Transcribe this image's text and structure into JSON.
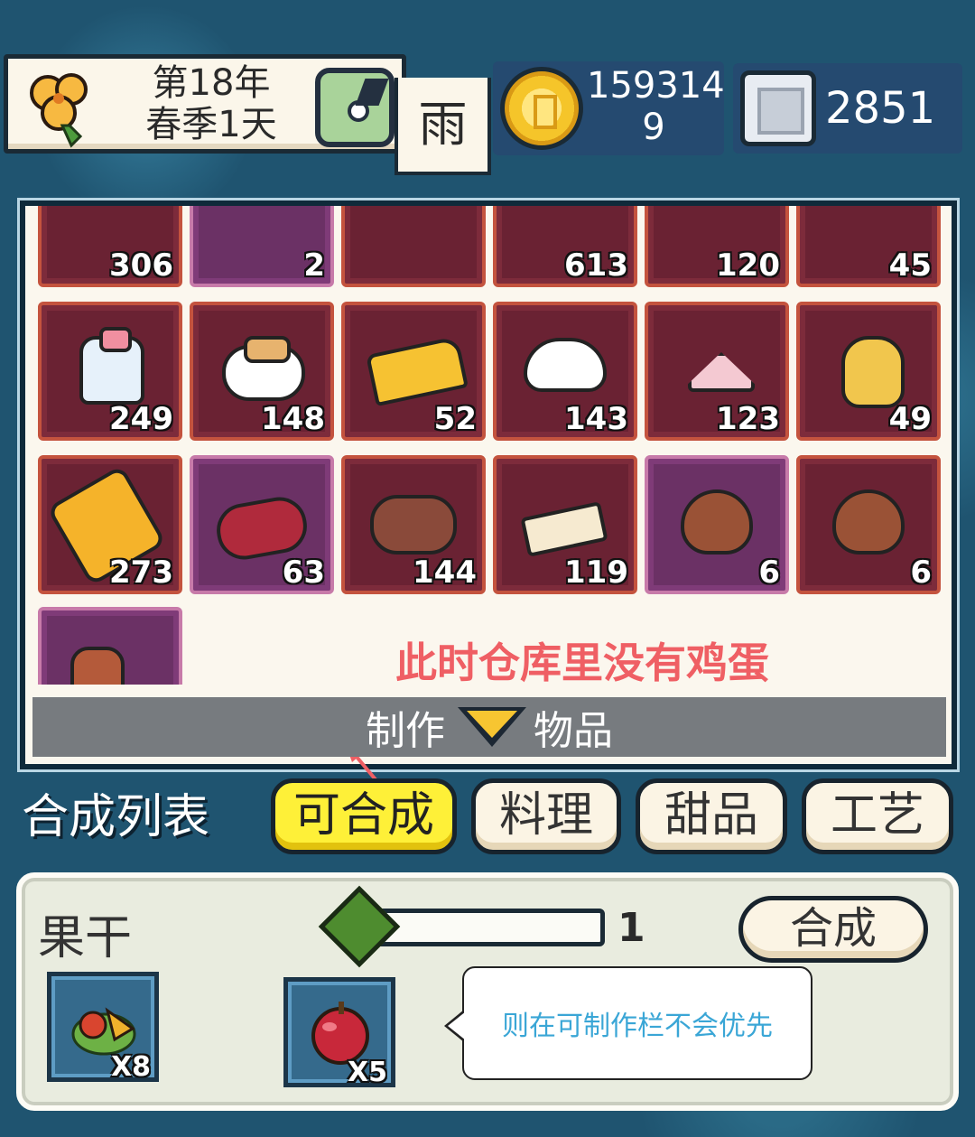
{
  "hud": {
    "date_line1": "第18年",
    "date_line2": "春季1天",
    "weather": "雨",
    "coins_line1": "159314",
    "coins_line2": "9",
    "gems": "2851"
  },
  "inventory": {
    "rows": [
      [
        {
          "icon": "water-drop-icon",
          "count": "306"
        },
        {
          "icon": "stump-icon",
          "count": "2"
        },
        {
          "icon": "stump-icon",
          "count": ""
        },
        {
          "icon": "rice-icon",
          "count": "613"
        },
        {
          "icon": "pea-icon",
          "count": "120"
        },
        {
          "icon": "fur-icon",
          "count": "45"
        }
      ],
      [
        {
          "icon": "milk-bottle-icon",
          "count": "249"
        },
        {
          "icon": "pudding-icon",
          "count": "148"
        },
        {
          "icon": "cheese-icon",
          "count": "52"
        },
        {
          "icon": "mushroom-icon",
          "count": "143"
        },
        {
          "icon": "tofu-icon",
          "count": "123"
        },
        {
          "icon": "oil-jar-icon",
          "count": "49"
        }
      ],
      [
        {
          "icon": "honeycomb-icon",
          "count": "273"
        },
        {
          "icon": "steak-icon",
          "count": "63"
        },
        {
          "icon": "meat-icon",
          "count": "144"
        },
        {
          "icon": "butter-icon",
          "count": "119"
        },
        {
          "icon": "drumstick-icon",
          "count": "6"
        },
        {
          "icon": "drumstick-icon",
          "count": "6"
        }
      ],
      [
        {
          "icon": "corn-icon",
          "count": ""
        }
      ]
    ],
    "annotation": "此时仓库里没有鸡蛋",
    "craft_bar_left": "制作",
    "craft_bar_right": "物品"
  },
  "craft_list": {
    "title": "合成列表",
    "tabs": [
      "可合成",
      "料理",
      "甜品",
      "工艺"
    ],
    "active_tab": 0
  },
  "recipe": {
    "name": "果干",
    "progress": 0,
    "quantity": "1",
    "synth_label": "合成",
    "ingredients": [
      {
        "icon": "dried-fruit-icon",
        "count": "X8"
      },
      {
        "icon": "apple-icon",
        "count": "X5"
      }
    ],
    "bubble_text": "则在可制作栏不会优先"
  },
  "colors": {
    "active_tab": "#fef038",
    "annotation": "#ef5f64",
    "bubble_text": "#3aa6d6"
  }
}
